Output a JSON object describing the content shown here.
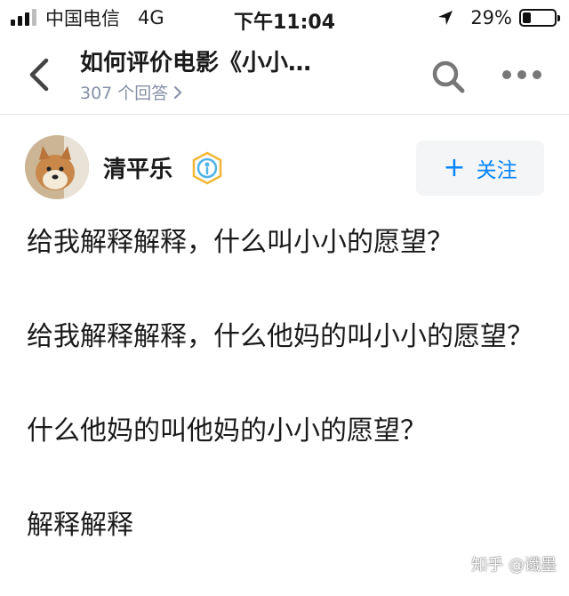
{
  "status_bar": {
    "carrier": "中国电信",
    "network": "4G",
    "time": "下午11:04",
    "battery_percent": "29%",
    "battery_level": 0.29,
    "signal_bars_filled": 3,
    "signal_bars_total": 4
  },
  "nav": {
    "title": "如何评价电影《小小…",
    "subtitle": "307 个回答",
    "back_icon": "chevron-left-icon",
    "search_icon": "search-icon",
    "more_icon": "more-icon"
  },
  "author": {
    "name": "清平乐",
    "badge_icon": "verified-badge-icon",
    "follow_label": "关注",
    "follow_icon": "plus-icon"
  },
  "answer": {
    "paragraphs": [
      "给我解释解释，什么叫小小的愿望？",
      "给我解释解释，什么他妈的叫小小的愿望？",
      "什么他妈的叫他妈的小小的愿望？",
      "解释解释"
    ]
  },
  "watermark": "知乎 @谶墨",
  "colors": {
    "accent": "#0084ff",
    "secondary_text": "#8590a6",
    "follow_bg": "#f3f5f7"
  }
}
